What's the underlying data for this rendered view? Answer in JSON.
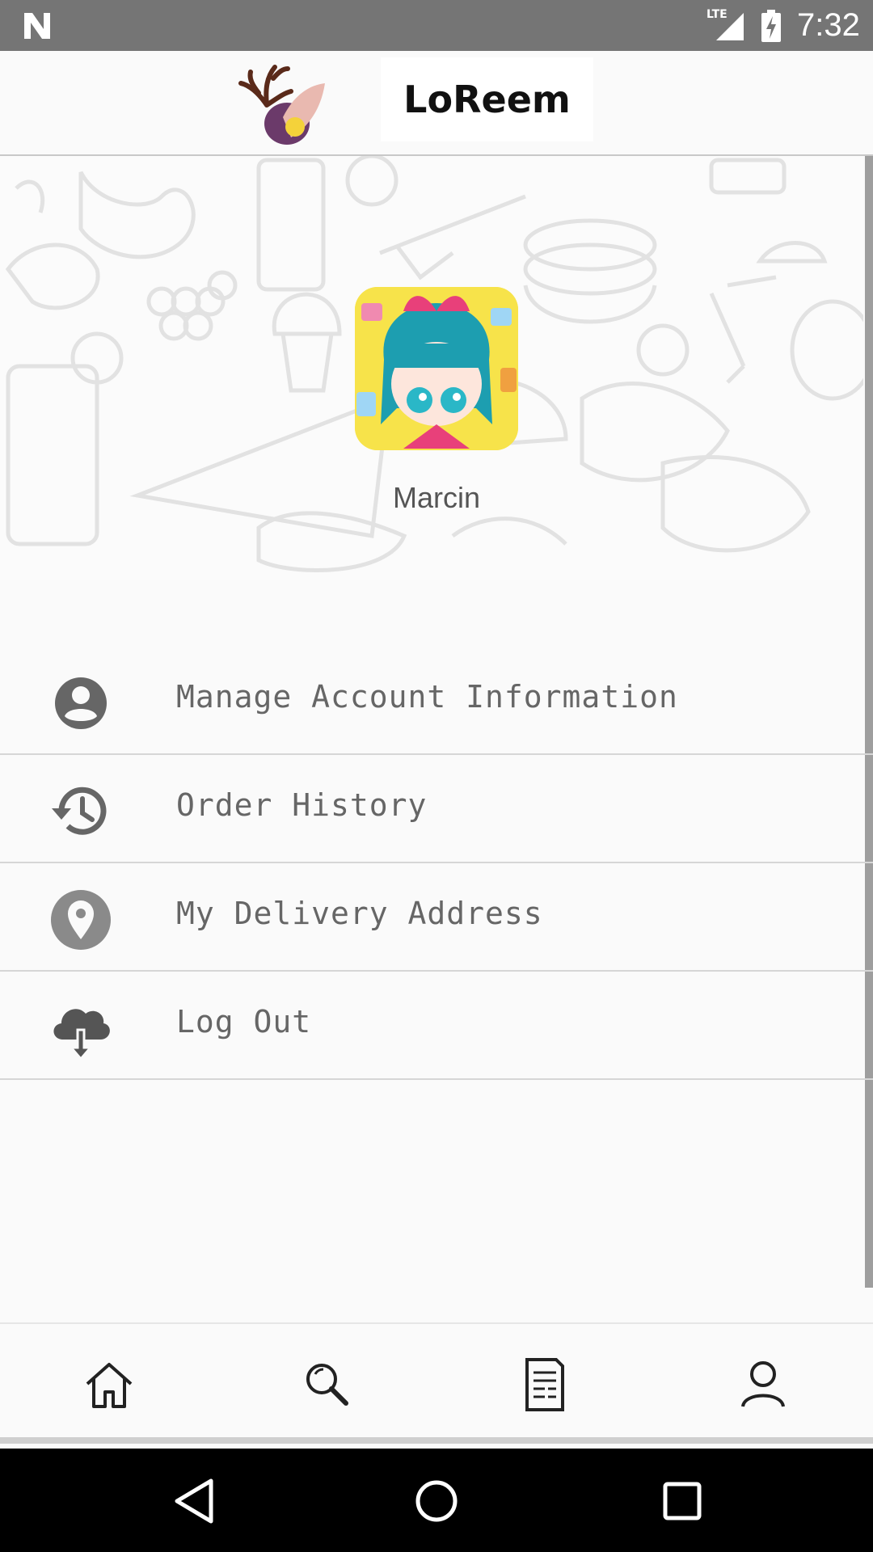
{
  "status_bar": {
    "network": "LTE",
    "time": "7:32",
    "icons": [
      "n-notification-icon",
      "lte-signal-icon",
      "battery-charging-icon"
    ]
  },
  "header": {
    "brand": "LoReem",
    "logo_icon": "deer-antler-logo-icon"
  },
  "profile": {
    "username": "Marcin",
    "avatar_icon": "anime-girl-avatar"
  },
  "menu": {
    "items": [
      {
        "label": "Manage Account Information",
        "icon": "account-circle-icon"
      },
      {
        "label": "Order History",
        "icon": "history-icon"
      },
      {
        "label": "My Delivery Address",
        "icon": "location-pin-icon"
      },
      {
        "label": "Log Out",
        "icon": "cloud-upload-icon"
      }
    ]
  },
  "bottom_nav": {
    "items": [
      {
        "icon": "home-icon"
      },
      {
        "icon": "search-icon"
      },
      {
        "icon": "orders-list-icon"
      },
      {
        "icon": "profile-icon"
      }
    ]
  },
  "colors": {
    "status_bar": "#757575",
    "icon_gray": "#666666",
    "background": "#fafafa"
  }
}
